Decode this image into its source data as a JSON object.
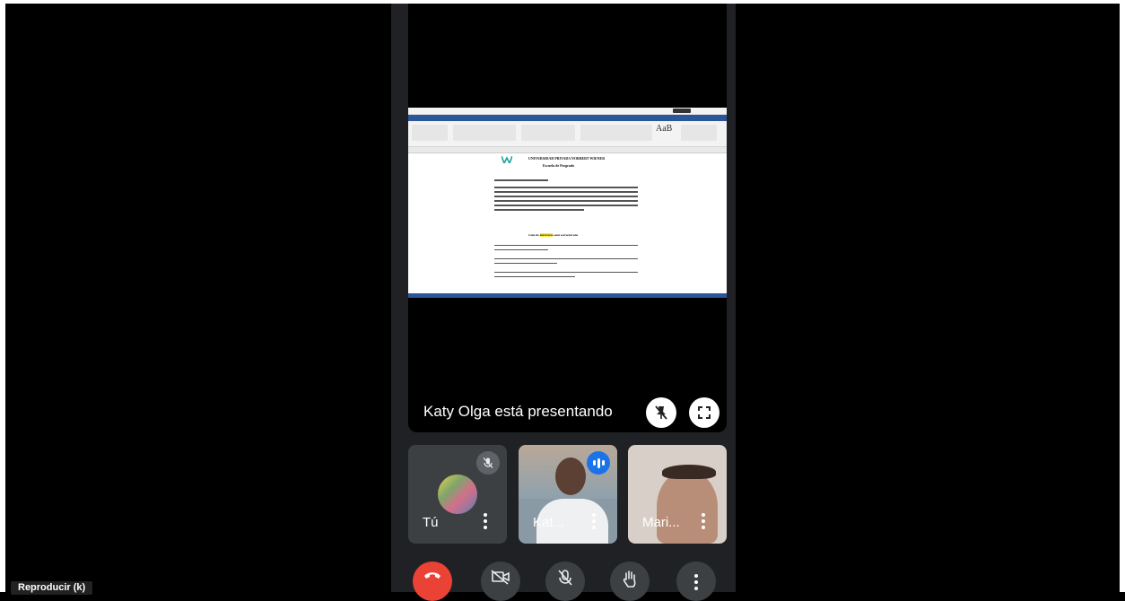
{
  "meeting": {
    "presenting_text": "Katy Olga está presentando"
  },
  "shared_screen": {
    "ribbon_style_sample": "AaB",
    "university": "UNIVERSIDAD PRIVADA NORBERT WIENER",
    "school": "Escuela de Posgrado",
    "guide_title_pre": "Guía de ",
    "guide_title_highlight": "entrevista",
    "guide_title_post": " semi estructurada"
  },
  "participants": [
    {
      "name": "Tú",
      "muted": true
    },
    {
      "name": "Kat...",
      "speaking": true
    },
    {
      "name": "Mari..."
    }
  ],
  "controls": {
    "end_call": "call-end-icon",
    "camera": "camera-off-icon",
    "mic": "mic-off-icon",
    "raise_hand": "hand-icon",
    "more": "more-vert-icon"
  },
  "player": {
    "tooltip": "Reproducir (k)"
  },
  "colors": {
    "end_call": "#ea4335",
    "speaking": "#1a73e8",
    "word_blue": "#2b579a",
    "dark_surface": "#202124"
  }
}
